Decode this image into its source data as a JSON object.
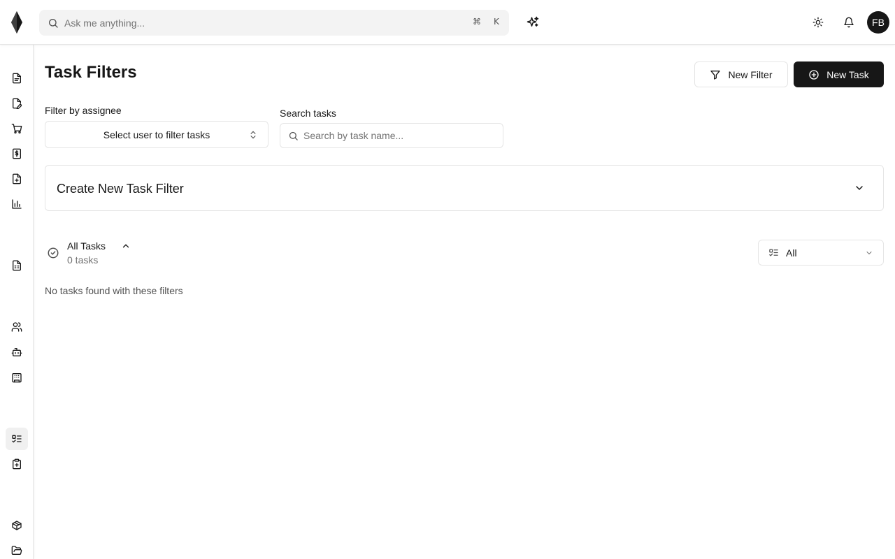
{
  "topbar": {
    "search_placeholder": "Ask me anything...",
    "shortcut_cmd": "⌘",
    "shortcut_key": "K",
    "avatar_initials": "FB"
  },
  "sidebar": {
    "items": [
      {
        "icon": "file-text-icon"
      },
      {
        "icon": "file-pen-icon"
      },
      {
        "icon": "shopping-cart-icon"
      },
      {
        "icon": "receipt-dollar-icon"
      },
      {
        "icon": "file-plus-icon"
      },
      {
        "icon": "bar-chart-icon"
      },
      {
        "icon": "file-spreadsheet-icon"
      },
      {
        "icon": "users-icon"
      },
      {
        "icon": "bot-icon"
      },
      {
        "icon": "building-icon"
      },
      {
        "icon": "list-checks-icon",
        "active": true
      },
      {
        "icon": "clipboard-plus-icon"
      },
      {
        "icon": "package-icon"
      },
      {
        "icon": "folder-open-icon"
      }
    ]
  },
  "page": {
    "title": "Task Filters",
    "new_filter_label": "New Filter",
    "new_task_label": "New Task"
  },
  "filters": {
    "assignee_label": "Filter by assignee",
    "assignee_value": "Select user to filter tasks",
    "search_label": "Search tasks",
    "search_placeholder": "Search by task name..."
  },
  "create_filter": {
    "title": "Create New Task Filter"
  },
  "tasks": {
    "title": "All Tasks",
    "count": "0 tasks",
    "view_value": "All",
    "empty_message": "No tasks found with these filters"
  },
  "colors": {
    "primary": "#171717",
    "border": "#e5e5e5",
    "muted_text": "#737373",
    "search_bg": "#f3f3f3"
  }
}
